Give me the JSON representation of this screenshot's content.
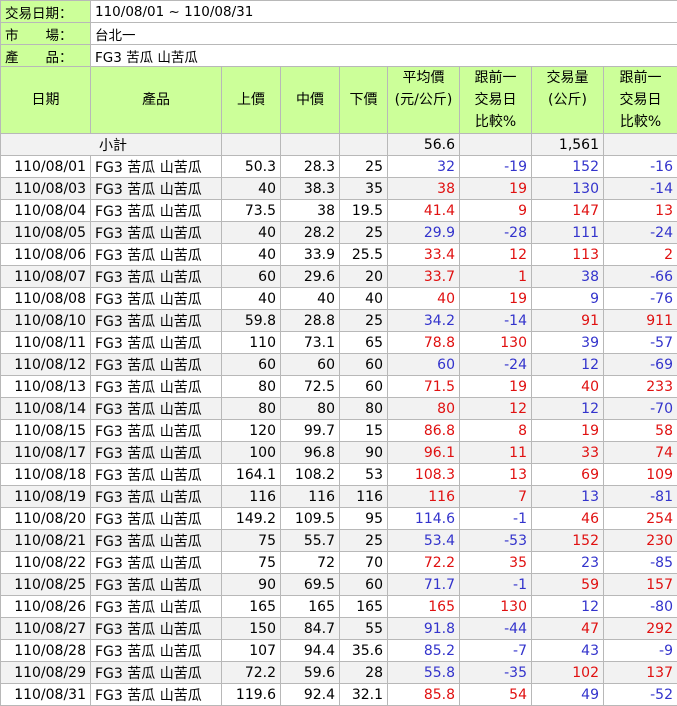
{
  "info": {
    "date_label": "交易日期：",
    "date_value": "110/08/01 ~ 110/08/31",
    "market_label": "市　　場：",
    "market_value": "台北一",
    "product_label": "產　　品：",
    "product_value": "FG3 苦瓜 山苦瓜"
  },
  "headers": {
    "date": "日期",
    "product": "產品",
    "high": "上價",
    "mid": "中價",
    "low": "下價",
    "avg_l1": "平均價",
    "avg_l2": "(元/公斤)",
    "cmp1_l1": "跟前一",
    "cmp1_l2": "交易日",
    "cmp1_l3": "比較%",
    "vol_l1": "交易量",
    "vol_l2": "(公斤)",
    "cmp2_l1": "跟前一",
    "cmp2_l2": "交易日",
    "cmp2_l3": "比較%"
  },
  "subtotal": {
    "label": "小計",
    "avg": "56.6",
    "volume": "1,561"
  },
  "colors": {
    "header_bg": "#ccff99",
    "negative": "#3333cc",
    "positive": "#e01010",
    "alt_row": "#f2f2f2"
  },
  "rows": [
    {
      "date": "110/08/01",
      "product": "FG3 苦瓜 山苦瓜",
      "high": "50.3",
      "mid": "28.3",
      "low": "25",
      "avg": "32",
      "avg_cmp": "-19",
      "volume": "152",
      "vol_cmp": "-16"
    },
    {
      "date": "110/08/03",
      "product": "FG3 苦瓜 山苦瓜",
      "high": "40",
      "mid": "38.3",
      "low": "35",
      "avg": "38",
      "avg_cmp": "19",
      "volume": "130",
      "vol_cmp": "-14"
    },
    {
      "date": "110/08/04",
      "product": "FG3 苦瓜 山苦瓜",
      "high": "73.5",
      "mid": "38",
      "low": "19.5",
      "avg": "41.4",
      "avg_cmp": "9",
      "volume": "147",
      "vol_cmp": "13"
    },
    {
      "date": "110/08/05",
      "product": "FG3 苦瓜 山苦瓜",
      "high": "40",
      "mid": "28.2",
      "low": "25",
      "avg": "29.9",
      "avg_cmp": "-28",
      "volume": "111",
      "vol_cmp": "-24"
    },
    {
      "date": "110/08/06",
      "product": "FG3 苦瓜 山苦瓜",
      "high": "40",
      "mid": "33.9",
      "low": "25.5",
      "avg": "33.4",
      "avg_cmp": "12",
      "volume": "113",
      "vol_cmp": "2"
    },
    {
      "date": "110/08/07",
      "product": "FG3 苦瓜 山苦瓜",
      "high": "60",
      "mid": "29.6",
      "low": "20",
      "avg": "33.7",
      "avg_cmp": "1",
      "volume": "38",
      "vol_cmp": "-66"
    },
    {
      "date": "110/08/08",
      "product": "FG3 苦瓜 山苦瓜",
      "high": "40",
      "mid": "40",
      "low": "40",
      "avg": "40",
      "avg_cmp": "19",
      "volume": "9",
      "vol_cmp": "-76"
    },
    {
      "date": "110/08/10",
      "product": "FG3 苦瓜 山苦瓜",
      "high": "59.8",
      "mid": "28.8",
      "low": "25",
      "avg": "34.2",
      "avg_cmp": "-14",
      "volume": "91",
      "vol_cmp": "911"
    },
    {
      "date": "110/08/11",
      "product": "FG3 苦瓜 山苦瓜",
      "high": "110",
      "mid": "73.1",
      "low": "65",
      "avg": "78.8",
      "avg_cmp": "130",
      "volume": "39",
      "vol_cmp": "-57"
    },
    {
      "date": "110/08/12",
      "product": "FG3 苦瓜 山苦瓜",
      "high": "60",
      "mid": "60",
      "low": "60",
      "avg": "60",
      "avg_cmp": "-24",
      "volume": "12",
      "vol_cmp": "-69"
    },
    {
      "date": "110/08/13",
      "product": "FG3 苦瓜 山苦瓜",
      "high": "80",
      "mid": "72.5",
      "low": "60",
      "avg": "71.5",
      "avg_cmp": "19",
      "volume": "40",
      "vol_cmp": "233"
    },
    {
      "date": "110/08/14",
      "product": "FG3 苦瓜 山苦瓜",
      "high": "80",
      "mid": "80",
      "low": "80",
      "avg": "80",
      "avg_cmp": "12",
      "volume": "12",
      "vol_cmp": "-70"
    },
    {
      "date": "110/08/15",
      "product": "FG3 苦瓜 山苦瓜",
      "high": "120",
      "mid": "99.7",
      "low": "15",
      "avg": "86.8",
      "avg_cmp": "8",
      "volume": "19",
      "vol_cmp": "58"
    },
    {
      "date": "110/08/17",
      "product": "FG3 苦瓜 山苦瓜",
      "high": "100",
      "mid": "96.8",
      "low": "90",
      "avg": "96.1",
      "avg_cmp": "11",
      "volume": "33",
      "vol_cmp": "74"
    },
    {
      "date": "110/08/18",
      "product": "FG3 苦瓜 山苦瓜",
      "high": "164.1",
      "mid": "108.2",
      "low": "53",
      "avg": "108.3",
      "avg_cmp": "13",
      "volume": "69",
      "vol_cmp": "109"
    },
    {
      "date": "110/08/19",
      "product": "FG3 苦瓜 山苦瓜",
      "high": "116",
      "mid": "116",
      "low": "116",
      "avg": "116",
      "avg_cmp": "7",
      "volume": "13",
      "vol_cmp": "-81"
    },
    {
      "date": "110/08/20",
      "product": "FG3 苦瓜 山苦瓜",
      "high": "149.2",
      "mid": "109.5",
      "low": "95",
      "avg": "114.6",
      "avg_cmp": "-1",
      "volume": "46",
      "vol_cmp": "254"
    },
    {
      "date": "110/08/21",
      "product": "FG3 苦瓜 山苦瓜",
      "high": "75",
      "mid": "55.7",
      "low": "25",
      "avg": "53.4",
      "avg_cmp": "-53",
      "volume": "152",
      "vol_cmp": "230"
    },
    {
      "date": "110/08/22",
      "product": "FG3 苦瓜 山苦瓜",
      "high": "75",
      "mid": "72",
      "low": "70",
      "avg": "72.2",
      "avg_cmp": "35",
      "volume": "23",
      "vol_cmp": "-85"
    },
    {
      "date": "110/08/25",
      "product": "FG3 苦瓜 山苦瓜",
      "high": "90",
      "mid": "69.5",
      "low": "60",
      "avg": "71.7",
      "avg_cmp": "-1",
      "volume": "59",
      "vol_cmp": "157"
    },
    {
      "date": "110/08/26",
      "product": "FG3 苦瓜 山苦瓜",
      "high": "165",
      "mid": "165",
      "low": "165",
      "avg": "165",
      "avg_cmp": "130",
      "volume": "12",
      "vol_cmp": "-80"
    },
    {
      "date": "110/08/27",
      "product": "FG3 苦瓜 山苦瓜",
      "high": "150",
      "mid": "84.7",
      "low": "55",
      "avg": "91.8",
      "avg_cmp": "-44",
      "volume": "47",
      "vol_cmp": "292"
    },
    {
      "date": "110/08/28",
      "product": "FG3 苦瓜 山苦瓜",
      "high": "107",
      "mid": "94.4",
      "low": "35.6",
      "avg": "85.2",
      "avg_cmp": "-7",
      "volume": "43",
      "vol_cmp": "-9"
    },
    {
      "date": "110/08/29",
      "product": "FG3 苦瓜 山苦瓜",
      "high": "72.2",
      "mid": "59.6",
      "low": "28",
      "avg": "55.8",
      "avg_cmp": "-35",
      "volume": "102",
      "vol_cmp": "137"
    },
    {
      "date": "110/08/31",
      "product": "FG3 苦瓜 山苦瓜",
      "high": "119.6",
      "mid": "92.4",
      "low": "32.1",
      "avg": "85.8",
      "avg_cmp": "54",
      "volume": "49",
      "vol_cmp": "-52"
    }
  ]
}
